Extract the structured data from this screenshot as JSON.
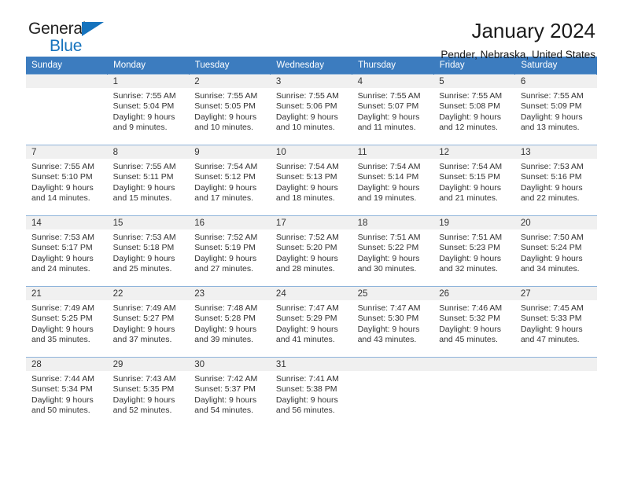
{
  "logo": {
    "word_one": "General",
    "word_two": "Blue",
    "triangle_color": "#1673bd",
    "text_color": "#222222"
  },
  "header": {
    "title": "January 2024",
    "subtitle": "Pender, Nebraska, United States"
  },
  "theme": {
    "header_bar_color": "#3c7cbf",
    "date_band_color": "#f0f0f0",
    "row_divider_color": "#8fb4da",
    "text_color": "#333333"
  },
  "calendar": {
    "weekday_headers": [
      "Sunday",
      "Monday",
      "Tuesday",
      "Wednesday",
      "Thursday",
      "Friday",
      "Saturday"
    ],
    "weeks": [
      [
        {
          "day": "",
          "sunrise": "",
          "sunset": "",
          "daylight_line1": "",
          "daylight_line2": ""
        },
        {
          "day": "1",
          "sunrise": "Sunrise: 7:55 AM",
          "sunset": "Sunset: 5:04 PM",
          "daylight_line1": "Daylight: 9 hours",
          "daylight_line2": "and 9 minutes."
        },
        {
          "day": "2",
          "sunrise": "Sunrise: 7:55 AM",
          "sunset": "Sunset: 5:05 PM",
          "daylight_line1": "Daylight: 9 hours",
          "daylight_line2": "and 10 minutes."
        },
        {
          "day": "3",
          "sunrise": "Sunrise: 7:55 AM",
          "sunset": "Sunset: 5:06 PM",
          "daylight_line1": "Daylight: 9 hours",
          "daylight_line2": "and 10 minutes."
        },
        {
          "day": "4",
          "sunrise": "Sunrise: 7:55 AM",
          "sunset": "Sunset: 5:07 PM",
          "daylight_line1": "Daylight: 9 hours",
          "daylight_line2": "and 11 minutes."
        },
        {
          "day": "5",
          "sunrise": "Sunrise: 7:55 AM",
          "sunset": "Sunset: 5:08 PM",
          "daylight_line1": "Daylight: 9 hours",
          "daylight_line2": "and 12 minutes."
        },
        {
          "day": "6",
          "sunrise": "Sunrise: 7:55 AM",
          "sunset": "Sunset: 5:09 PM",
          "daylight_line1": "Daylight: 9 hours",
          "daylight_line2": "and 13 minutes."
        }
      ],
      [
        {
          "day": "7",
          "sunrise": "Sunrise: 7:55 AM",
          "sunset": "Sunset: 5:10 PM",
          "daylight_line1": "Daylight: 9 hours",
          "daylight_line2": "and 14 minutes."
        },
        {
          "day": "8",
          "sunrise": "Sunrise: 7:55 AM",
          "sunset": "Sunset: 5:11 PM",
          "daylight_line1": "Daylight: 9 hours",
          "daylight_line2": "and 15 minutes."
        },
        {
          "day": "9",
          "sunrise": "Sunrise: 7:54 AM",
          "sunset": "Sunset: 5:12 PM",
          "daylight_line1": "Daylight: 9 hours",
          "daylight_line2": "and 17 minutes."
        },
        {
          "day": "10",
          "sunrise": "Sunrise: 7:54 AM",
          "sunset": "Sunset: 5:13 PM",
          "daylight_line1": "Daylight: 9 hours",
          "daylight_line2": "and 18 minutes."
        },
        {
          "day": "11",
          "sunrise": "Sunrise: 7:54 AM",
          "sunset": "Sunset: 5:14 PM",
          "daylight_line1": "Daylight: 9 hours",
          "daylight_line2": "and 19 minutes."
        },
        {
          "day": "12",
          "sunrise": "Sunrise: 7:54 AM",
          "sunset": "Sunset: 5:15 PM",
          "daylight_line1": "Daylight: 9 hours",
          "daylight_line2": "and 21 minutes."
        },
        {
          "day": "13",
          "sunrise": "Sunrise: 7:53 AM",
          "sunset": "Sunset: 5:16 PM",
          "daylight_line1": "Daylight: 9 hours",
          "daylight_line2": "and 22 minutes."
        }
      ],
      [
        {
          "day": "14",
          "sunrise": "Sunrise: 7:53 AM",
          "sunset": "Sunset: 5:17 PM",
          "daylight_line1": "Daylight: 9 hours",
          "daylight_line2": "and 24 minutes."
        },
        {
          "day": "15",
          "sunrise": "Sunrise: 7:53 AM",
          "sunset": "Sunset: 5:18 PM",
          "daylight_line1": "Daylight: 9 hours",
          "daylight_line2": "and 25 minutes."
        },
        {
          "day": "16",
          "sunrise": "Sunrise: 7:52 AM",
          "sunset": "Sunset: 5:19 PM",
          "daylight_line1": "Daylight: 9 hours",
          "daylight_line2": "and 27 minutes."
        },
        {
          "day": "17",
          "sunrise": "Sunrise: 7:52 AM",
          "sunset": "Sunset: 5:20 PM",
          "daylight_line1": "Daylight: 9 hours",
          "daylight_line2": "and 28 minutes."
        },
        {
          "day": "18",
          "sunrise": "Sunrise: 7:51 AM",
          "sunset": "Sunset: 5:22 PM",
          "daylight_line1": "Daylight: 9 hours",
          "daylight_line2": "and 30 minutes."
        },
        {
          "day": "19",
          "sunrise": "Sunrise: 7:51 AM",
          "sunset": "Sunset: 5:23 PM",
          "daylight_line1": "Daylight: 9 hours",
          "daylight_line2": "and 32 minutes."
        },
        {
          "day": "20",
          "sunrise": "Sunrise: 7:50 AM",
          "sunset": "Sunset: 5:24 PM",
          "daylight_line1": "Daylight: 9 hours",
          "daylight_line2": "and 34 minutes."
        }
      ],
      [
        {
          "day": "21",
          "sunrise": "Sunrise: 7:49 AM",
          "sunset": "Sunset: 5:25 PM",
          "daylight_line1": "Daylight: 9 hours",
          "daylight_line2": "and 35 minutes."
        },
        {
          "day": "22",
          "sunrise": "Sunrise: 7:49 AM",
          "sunset": "Sunset: 5:27 PM",
          "daylight_line1": "Daylight: 9 hours",
          "daylight_line2": "and 37 minutes."
        },
        {
          "day": "23",
          "sunrise": "Sunrise: 7:48 AM",
          "sunset": "Sunset: 5:28 PM",
          "daylight_line1": "Daylight: 9 hours",
          "daylight_line2": "and 39 minutes."
        },
        {
          "day": "24",
          "sunrise": "Sunrise: 7:47 AM",
          "sunset": "Sunset: 5:29 PM",
          "daylight_line1": "Daylight: 9 hours",
          "daylight_line2": "and 41 minutes."
        },
        {
          "day": "25",
          "sunrise": "Sunrise: 7:47 AM",
          "sunset": "Sunset: 5:30 PM",
          "daylight_line1": "Daylight: 9 hours",
          "daylight_line2": "and 43 minutes."
        },
        {
          "day": "26",
          "sunrise": "Sunrise: 7:46 AM",
          "sunset": "Sunset: 5:32 PM",
          "daylight_line1": "Daylight: 9 hours",
          "daylight_line2": "and 45 minutes."
        },
        {
          "day": "27",
          "sunrise": "Sunrise: 7:45 AM",
          "sunset": "Sunset: 5:33 PM",
          "daylight_line1": "Daylight: 9 hours",
          "daylight_line2": "and 47 minutes."
        }
      ],
      [
        {
          "day": "28",
          "sunrise": "Sunrise: 7:44 AM",
          "sunset": "Sunset: 5:34 PM",
          "daylight_line1": "Daylight: 9 hours",
          "daylight_line2": "and 50 minutes."
        },
        {
          "day": "29",
          "sunrise": "Sunrise: 7:43 AM",
          "sunset": "Sunset: 5:35 PM",
          "daylight_line1": "Daylight: 9 hours",
          "daylight_line2": "and 52 minutes."
        },
        {
          "day": "30",
          "sunrise": "Sunrise: 7:42 AM",
          "sunset": "Sunset: 5:37 PM",
          "daylight_line1": "Daylight: 9 hours",
          "daylight_line2": "and 54 minutes."
        },
        {
          "day": "31",
          "sunrise": "Sunrise: 7:41 AM",
          "sunset": "Sunset: 5:38 PM",
          "daylight_line1": "Daylight: 9 hours",
          "daylight_line2": "and 56 minutes."
        },
        {
          "day": "",
          "sunrise": "",
          "sunset": "",
          "daylight_line1": "",
          "daylight_line2": ""
        },
        {
          "day": "",
          "sunrise": "",
          "sunset": "",
          "daylight_line1": "",
          "daylight_line2": ""
        },
        {
          "day": "",
          "sunrise": "",
          "sunset": "",
          "daylight_line1": "",
          "daylight_line2": ""
        }
      ]
    ]
  }
}
